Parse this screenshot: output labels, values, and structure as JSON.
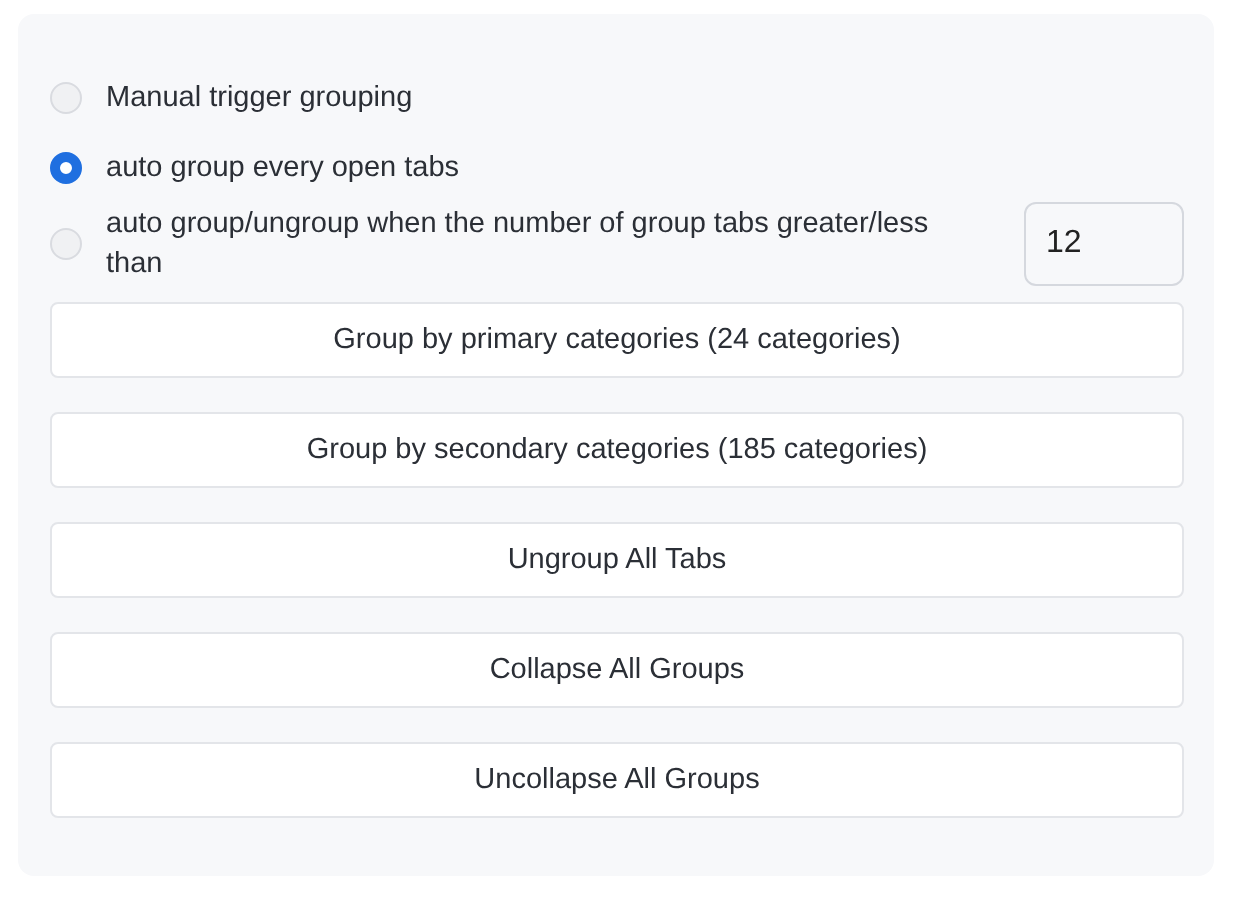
{
  "grouping_options": [
    {
      "kind": "plain",
      "label": "Manual trigger grouping",
      "selected": false
    },
    {
      "kind": "plain",
      "label": "auto group every open tabs",
      "selected": true
    },
    {
      "kind": "with-field",
      "label": "auto group/ungroup when the number of group tabs greater/less than",
      "selected": false,
      "value": "12"
    }
  ],
  "buttons": [
    "Group by primary categories (24 categories)",
    "Group by secondary categories (185 categories)",
    "Ungroup All Tabs",
    "Collapse All Groups",
    "Uncollapse All Groups"
  ]
}
